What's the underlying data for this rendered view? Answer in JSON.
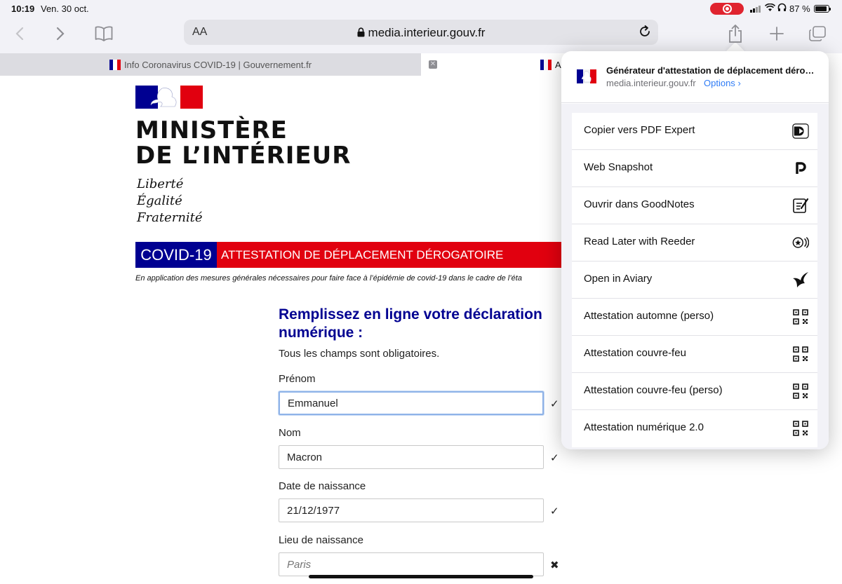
{
  "status": {
    "time": "10:19",
    "date": "Ven. 30 oct.",
    "battery": "87 %"
  },
  "toolbar": {
    "text_size_label": "AA",
    "url": "media.interieur.gouv.fr"
  },
  "tabs": [
    {
      "label": "Info Coronavirus COVID-19 | Gouvernement.fr"
    },
    {
      "label": "A"
    }
  ],
  "page": {
    "ministry": [
      "MINISTÈRE",
      "DE L’INTÉRIEUR"
    ],
    "motto": [
      "Liberté",
      "Égalité",
      "Fraternité"
    ],
    "banner": {
      "covid": "COVID-19",
      "title": "ATTESTATION DE DÉPLACEMENT DÉROGATOIRE"
    },
    "legal": "En application des mesures générales nécessaires pour faire face à l’épidémie de covid-19 dans le cadre de l’éta",
    "form": {
      "title": "Remplissez en ligne votre déclaration numérique :",
      "subtitle": "Tous les champs sont obligatoires.",
      "fields": [
        {
          "label": "Prénom",
          "value": "Emmanuel",
          "status": "✓"
        },
        {
          "label": "Nom",
          "value": "Macron",
          "status": "✓"
        },
        {
          "label": "Date de naissance",
          "value": "21/12/1977",
          "status": "✓"
        },
        {
          "label": "Lieu de naissance",
          "placeholder": "Paris",
          "status": "✖"
        }
      ]
    }
  },
  "share_sheet": {
    "title": "Générateur d'attestation de déplacement dérog...",
    "domain": "media.interieur.gouv.fr",
    "options": "Options",
    "options_chevron": "›",
    "actions": [
      {
        "label": "Copier vers PDF Expert",
        "icon": "pdf-expert-icon"
      },
      {
        "label": "Web Snapshot",
        "icon": "web-snapshot-icon"
      },
      {
        "label": "Ouvrir dans GoodNotes",
        "icon": "goodnotes-icon"
      },
      {
        "label": "Read Later with Reeder",
        "icon": "reeder-icon"
      },
      {
        "label": "Open in Aviary",
        "icon": "aviary-icon"
      },
      {
        "label": "Attestation automne (perso)",
        "icon": "qr-code-icon"
      },
      {
        "label": "Attestation couvre-feu",
        "icon": "qr-code-icon"
      },
      {
        "label": "Attestation couvre-feu (perso)",
        "icon": "qr-code-icon"
      },
      {
        "label": "Attestation numérique 2.0",
        "icon": "qr-code-icon"
      }
    ]
  },
  "colors": {
    "french_blue": "#000091",
    "french_red": "#e1000f",
    "link_blue": "#2f7cf6"
  }
}
